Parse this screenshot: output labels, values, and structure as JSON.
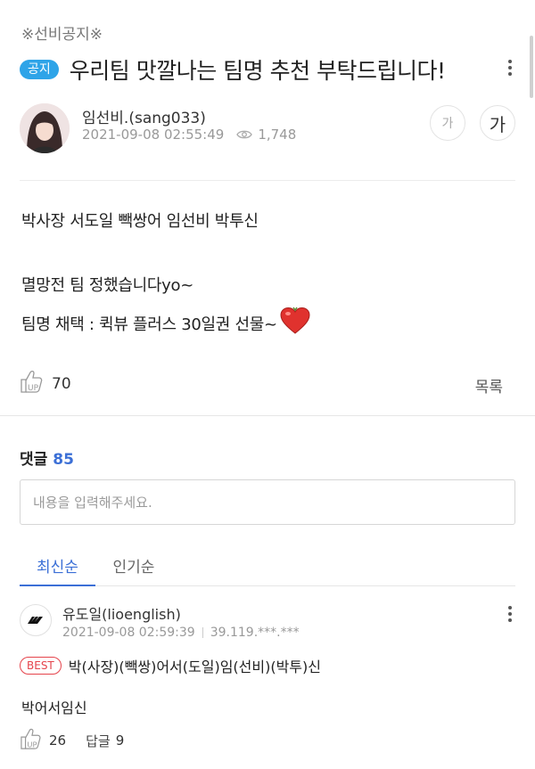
{
  "post": {
    "category": "※선비공지※",
    "badge": "공지",
    "title": "우리팀 맛깔나는 팀명 추천 부탁드립니다!",
    "author": "임선비.(sang033)",
    "datetime": "2021-09-08 02:55:49",
    "views": "1,748",
    "font_small_label": "가",
    "font_large_label": "가",
    "body_line1": "박사장 서도일 빽쌍어 임선비 박투신",
    "body_line2": "멸망전 팀 정했습니다yo~",
    "body_line3": "팀명 채택 : 퀵뷰 플러스 30일권 선물~",
    "likes": "70",
    "list_label": "목록"
  },
  "comments": {
    "heading": "댓글",
    "count": "85",
    "input_placeholder": "내용을 입력해주세요.",
    "tabs": [
      {
        "label": "최신순",
        "active": true
      },
      {
        "label": "인기순",
        "active": false
      }
    ],
    "items": [
      {
        "author": "유도일(lioenglish)",
        "datetime": "2021-09-08 02:59:39",
        "ip": "39.119.***.***",
        "best_badge": "BEST",
        "best_text": "박(사장)(빽쌍)어서(도일)임(선비)(박투)신",
        "body": "박어서임신",
        "likes": "26",
        "reply_label": "답글",
        "reply_count": "9"
      }
    ]
  },
  "colors": {
    "notice_badge": "#2ea4e8",
    "accent_blue": "#3b6fd6",
    "best_red": "#e5434b",
    "heart_red": "#e0322e"
  },
  "icons": [
    "kebab-menu-icon",
    "eye-icon",
    "heart-icon",
    "thumbs-up-icon",
    "brand-logo-icon"
  ]
}
